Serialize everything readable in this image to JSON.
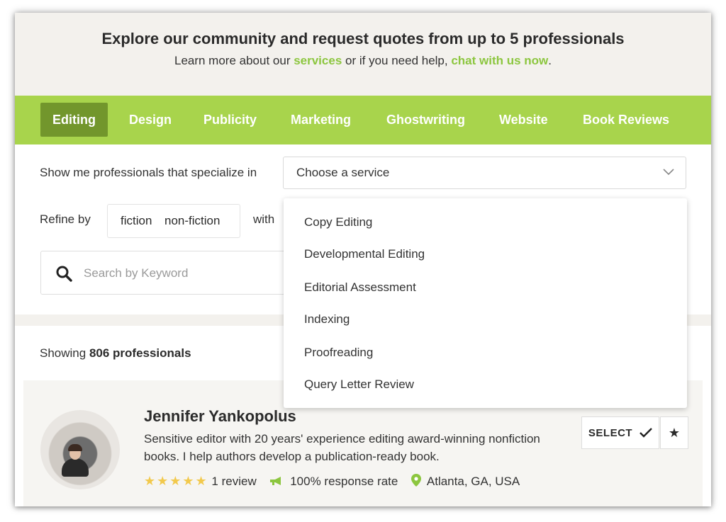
{
  "hero": {
    "title": "Explore our community and request quotes from up to 5 professionals",
    "sub_prefix": "Learn more about our ",
    "sub_link1": "services",
    "sub_mid": " or if you need help, ",
    "sub_link2": "chat with us now",
    "sub_suffix": "."
  },
  "tabs": [
    "Editing",
    "Design",
    "Publicity",
    "Marketing",
    "Ghostwriting",
    "Website",
    "Book Reviews"
  ],
  "filters": {
    "specialize_label": "Show me professionals that specialize in",
    "service_select_value": "Choose a service",
    "refine_label": "Refine by",
    "chip_fiction": "fiction",
    "chip_nonfiction": "non-fiction",
    "with_label": "with",
    "search_placeholder": "Search by Keyword"
  },
  "dropdown": {
    "options": [
      "Copy Editing",
      "Developmental Editing",
      "Editorial Assessment",
      "Indexing",
      "Proofreading",
      "Query Letter Review"
    ]
  },
  "results": {
    "showing_prefix": "Showing ",
    "count": "806 professionals"
  },
  "card": {
    "name": "Jennifer Yankopolus",
    "bio": "Sensitive editor with 20 years' experience editing award-winning nonfiction books. I help authors develop a publication-ready book.",
    "stars": "★★★★★",
    "reviews": "1 review",
    "response_rate": "100% response rate",
    "location": "Atlanta, GA, USA",
    "select_label": "SELECT"
  },
  "colors": {
    "accent_green": "#a8d44c",
    "active_tab": "#72962c",
    "link_green": "#8cc63f",
    "star_yellow": "#f2c94c"
  }
}
